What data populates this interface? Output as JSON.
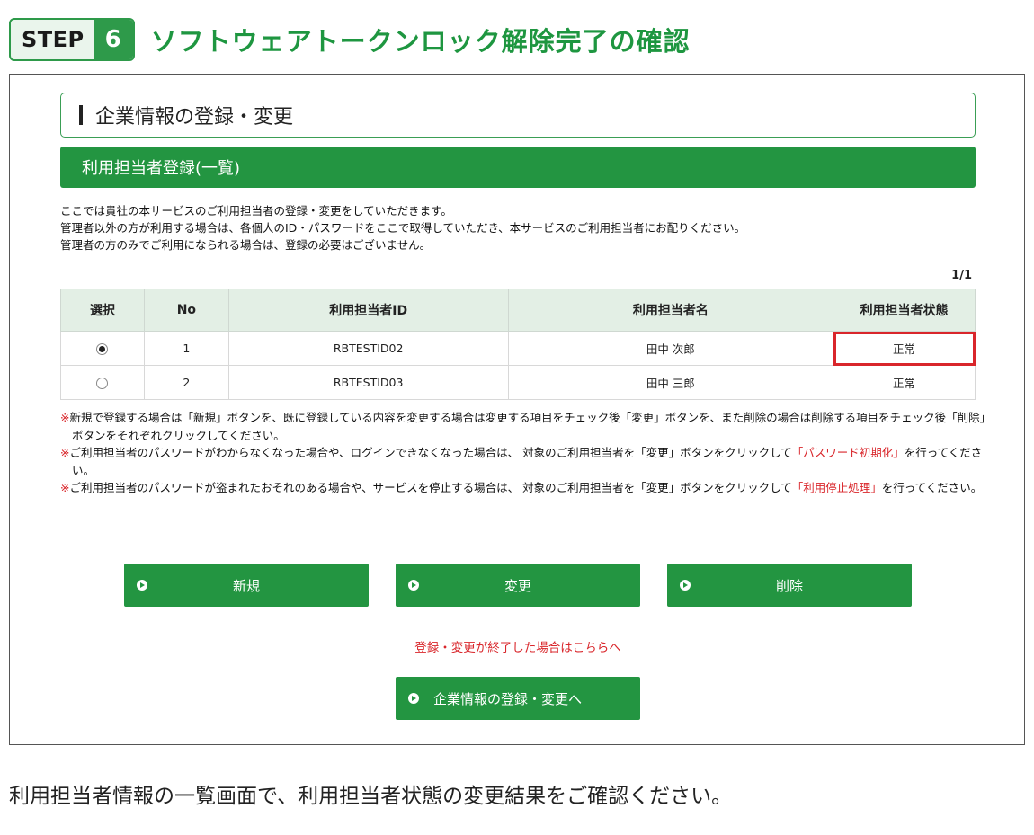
{
  "step": {
    "word": "STEP",
    "number": "6",
    "title": "ソフトウェアトークンロック解除完了の確認"
  },
  "section": {
    "title": "企業情報の登録・変更"
  },
  "band": {
    "title": "利用担当者登録(一覧)"
  },
  "description": [
    "ここでは貴社の本サービスのご利用担当者の登録・変更をしていただきます。",
    "管理者以外の方が利用する場合は、各個人のID・パスワードをここで取得していただき、本サービスのご利用担当者にお配りください。",
    "管理者の方のみでご利用になられる場合は、登録の必要はございません。"
  ],
  "pager": "1/1",
  "table": {
    "headers": [
      "選択",
      "No",
      "利用担当者ID",
      "利用担当者名",
      "利用担当者状態"
    ],
    "rows": [
      {
        "selected": true,
        "no": "1",
        "id": "RBTESTID02",
        "name": "田中 次郎",
        "status": "正常"
      },
      {
        "selected": false,
        "no": "2",
        "id": "RBTESTID03",
        "name": "田中 三郎",
        "status": "正常"
      }
    ]
  },
  "notes": {
    "mark": "※",
    "note1": "新規で登録する場合は「新規」ボタンを、既に登録している内容を変更する場合は変更する項目をチェック後「変更」ボタンを、また削除の場合は削除する項目をチェック後「削除」ボタンをそれぞれクリックしてください。",
    "note2_pre": "ご利用担当者のパスワードがわからなくなった場合や、ログインできなくなった場合は、 対象のご利用担当者を「変更」ボタンをクリックして",
    "note2_red": "「パスワード初期化」",
    "note2_post": "を行ってください。",
    "note3_pre": "ご利用担当者のパスワードが盗まれたおそれのある場合や、サービスを停止する場合は、 対象のご利用担当者を「変更」ボタンをクリックして",
    "note3_red": "「利用停止処理」",
    "note3_post": "を行ってください。"
  },
  "buttons": {
    "new": "新規",
    "edit": "変更",
    "delete": "削除",
    "back": "企業情報の登録・変更へ"
  },
  "finish_link": "登録・変更が終了した場合はこちらへ",
  "caption": "利用担当者情報の一覧画面で、利用担当者状態の変更結果をご確認ください。",
  "colors": {
    "green": "#239541",
    "highlight": "#d9262b",
    "header_bg": "#e3efe5"
  }
}
